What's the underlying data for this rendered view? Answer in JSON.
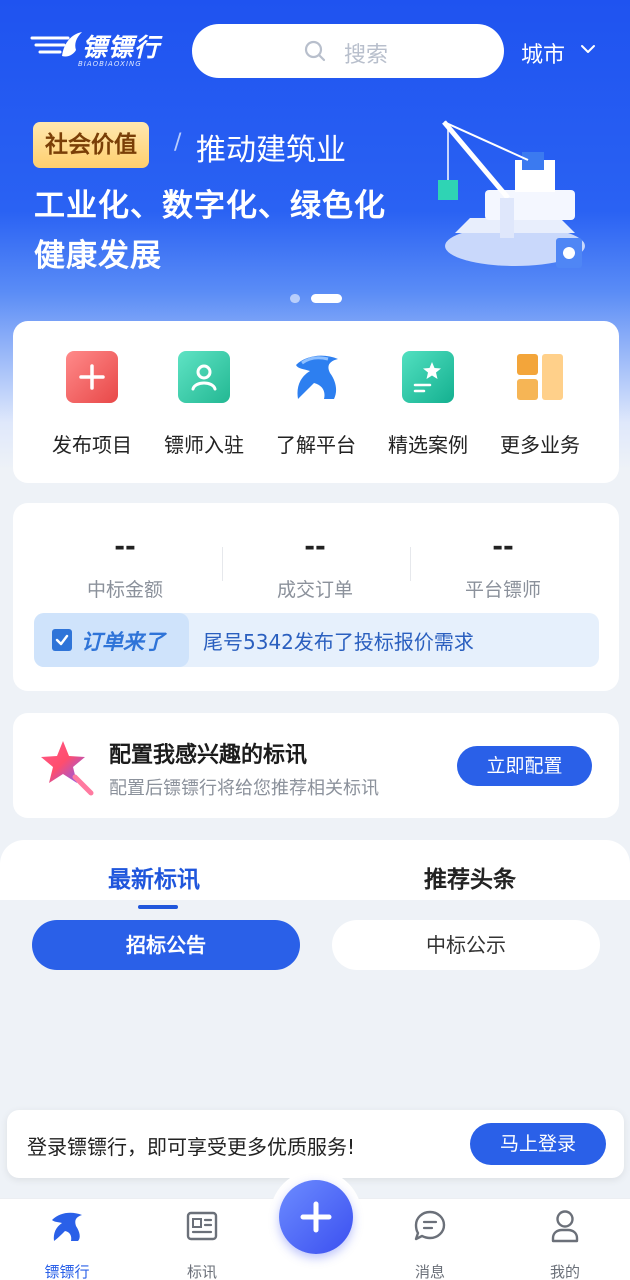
{
  "header": {
    "logo_text": "镖镖行",
    "logo_sub": "BIAOBIAOXING",
    "search_placeholder": "搜索",
    "city_label": "城市"
  },
  "banner": {
    "tag": "社会价值",
    "separator": "/",
    "subtitle": "推动建筑业",
    "line1": "工业化、数字化、绿色化",
    "line2": "健康发展",
    "slides": 2,
    "active_slide": 2
  },
  "services": [
    {
      "label": "发布项目",
      "icon": "add-square-icon",
      "color": "#f05a5a"
    },
    {
      "label": "镖师入驻",
      "icon": "user-card-icon",
      "color": "#2fc7a4"
    },
    {
      "label": "了解平台",
      "icon": "horse-logo-icon",
      "color": "#2d7ff0"
    },
    {
      "label": "精选案例",
      "icon": "star-board-icon",
      "color": "#22c3a6"
    },
    {
      "label": "更多业务",
      "icon": "grid-blocks-icon",
      "color": "#f3a53a"
    }
  ],
  "stats": [
    {
      "value": "--",
      "label": "中标金额"
    },
    {
      "value": "--",
      "label": "成交订单"
    },
    {
      "value": "--",
      "label": "平台镖师"
    }
  ],
  "notice": {
    "title": "订单来了",
    "text": "尾号5342发布了投标报价需求"
  },
  "config": {
    "title": "配置我感兴趣的标讯",
    "subtitle": "配置后镖镖行将给您推荐相关标讯",
    "button": "立即配置"
  },
  "tabs": {
    "latest": "最新标讯",
    "recommended": "推荐头条",
    "active": "latest"
  },
  "filters": {
    "tender": "招标公告",
    "award": "中标公示",
    "active": "tender"
  },
  "login_bar": {
    "text": "登录镖镖行，即可享受更多优质服务!",
    "button": "马上登录"
  },
  "nav": {
    "home": "镖镖行",
    "bids": "标讯",
    "messages": "消息",
    "mine": "我的",
    "active": "home"
  },
  "colors": {
    "primary": "#2a60e8",
    "hero_top": "#1f53f0",
    "tag_bg": "#ffcf6e"
  }
}
